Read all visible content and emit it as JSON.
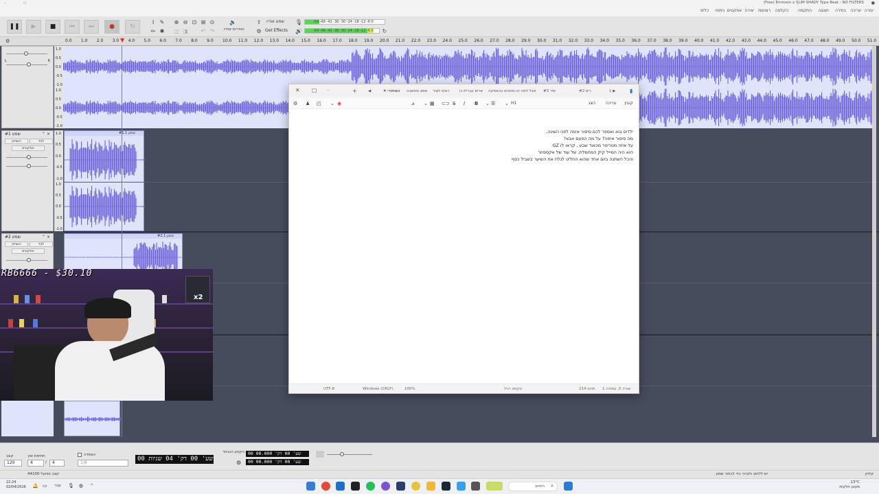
{
  "window": {
    "title": "(Free) Eminem x SLIM SHADY Type Beat - NO FILTERS"
  },
  "menu": [
    "עזרה",
    "עריכה",
    "בחירה",
    "תצוגה",
    "התקמה",
    "הקלטה",
    "רצועות",
    "יצירה",
    "אפקטים",
    "ניתוח",
    "כלים",
    "עזרה"
  ],
  "toolbar": {
    "audio_setup": "שמע אודיו",
    "share_audio": "הגדרות אודיו",
    "get_effects": "Get Effects",
    "meter_record_scale": "-54 -48 -42 -36 -30 -24 -18 -12 -6 0",
    "meter_play_scale": "-54 -48 -42 -36 -30 -24 -18 -12 -6 0",
    "record_meter_level": 0.18,
    "play_meter_level": 0.92
  },
  "ruler": {
    "ticks": [
      "0.0",
      "1.0",
      "2.0",
      "3.0",
      "4.0",
      "5.0",
      "6.0",
      "7.0",
      "8.0",
      "9.0",
      "10.0",
      "11.0",
      "12.0",
      "13.0",
      "14.0",
      "15.0",
      "16.0",
      "17.0",
      "18.0",
      "19.0",
      "20.0",
      "21.0",
      "22.0",
      "23.0",
      "24.0",
      "25.0",
      "26.0",
      "27.0",
      "28.0",
      "29.0",
      "30.0",
      "31.0",
      "32.0",
      "33.0",
      "34.0",
      "35.0",
      "36.0",
      "37.0",
      "38.0",
      "39.0",
      "40.0",
      "41.0",
      "42.0",
      "43.0",
      "44.0",
      "45.0",
      "46.0",
      "47.0",
      "48.0",
      "49.0",
      "50.0",
      "51.0"
    ]
  },
  "tracks": [
    {
      "name": "",
      "mute": "השתק",
      "solo": "לבד",
      "effects": "אפקטים",
      "clip_label": ""
    },
    {
      "name": "שמע #1",
      "mute": "השתק",
      "solo": "לבד",
      "effects": "אפקטים",
      "clip_label": "שמע #1.1"
    },
    {
      "name": "שמע #2",
      "mute": "השתק",
      "solo": "לבד",
      "effects": "אפקטים",
      "clip_label": "שמע #2.1"
    }
  ],
  "scale_labels": [
    "1.0",
    "0.5",
    "0.0",
    "-0.5",
    "-1.0"
  ],
  "notepad": {
    "tabs": [
      "שפצ מחשבה",
      "רצים לשיר",
      "הצצה",
      "מחכים בהאפקה",
      "זאן המוכלכים",
      "שרים עברית כו",
      "עשרות עברית",
      "אחר הזמן ההן",
      "אבל למה זה",
      "שיר #3",
      "ריס #2"
    ],
    "active_tab": "כשחזורי",
    "menu": [
      "קובץ",
      "עריכה",
      "הצג"
    ],
    "heading_btn": "H1",
    "lines": [
      "ילדים בוא ואספר לכם סיפור אימה לפני השינה,",
      "מה סיפור אימה? על מה הפעם אבא?",
      "על איזה מטריפר מכאוד שבע , קראו לו GZ",
      "הוא היה המייל קיק המחמלת, של עוד של אקספוזר",
      "והכל השתנה ביום אחד שהוא החליט לגלח את השיער בשביל כסף"
    ],
    "status": {
      "position": "שורה 5, עמודה 1",
      "chars": "214 תווים",
      "format": "טקסט רגיל",
      "zoom": "100%",
      "line_endings": "Windows (CRLF)",
      "encoding": "UTF-8"
    }
  },
  "webcam": {
    "overlay": "RB6666 - $30.10",
    "badge": "x2"
  },
  "selection_toolbar": {
    "snap_label": "קצב",
    "snap_value": "120",
    "time_sig_label": "חתימת זמן",
    "time_sig_num": "4",
    "time_sig_den": "4",
    "snap_check_label": "הצמדה",
    "snap_fraction": "1/8",
    "big_time": "00 שע' 00 דק' 04 שניות",
    "selection_label": "הקטע הנבחר",
    "sel_start": "00 שע' 00 דק' 00.000 ש'",
    "sel_end": "00 שע' 00 דק' 00.000 ש'"
  },
  "statusbar": {
    "left": "44100 קצב בפועל",
    "right": "קלוק",
    "hint": "יש ללחוץ ולגרור כדי לבחור שמע"
  },
  "taskbar": {
    "time": "22:24",
    "date": "02/04/2026",
    "search": "חיפוש",
    "weather": "13°C",
    "weather_desc": "מעונן חלקית"
  }
}
